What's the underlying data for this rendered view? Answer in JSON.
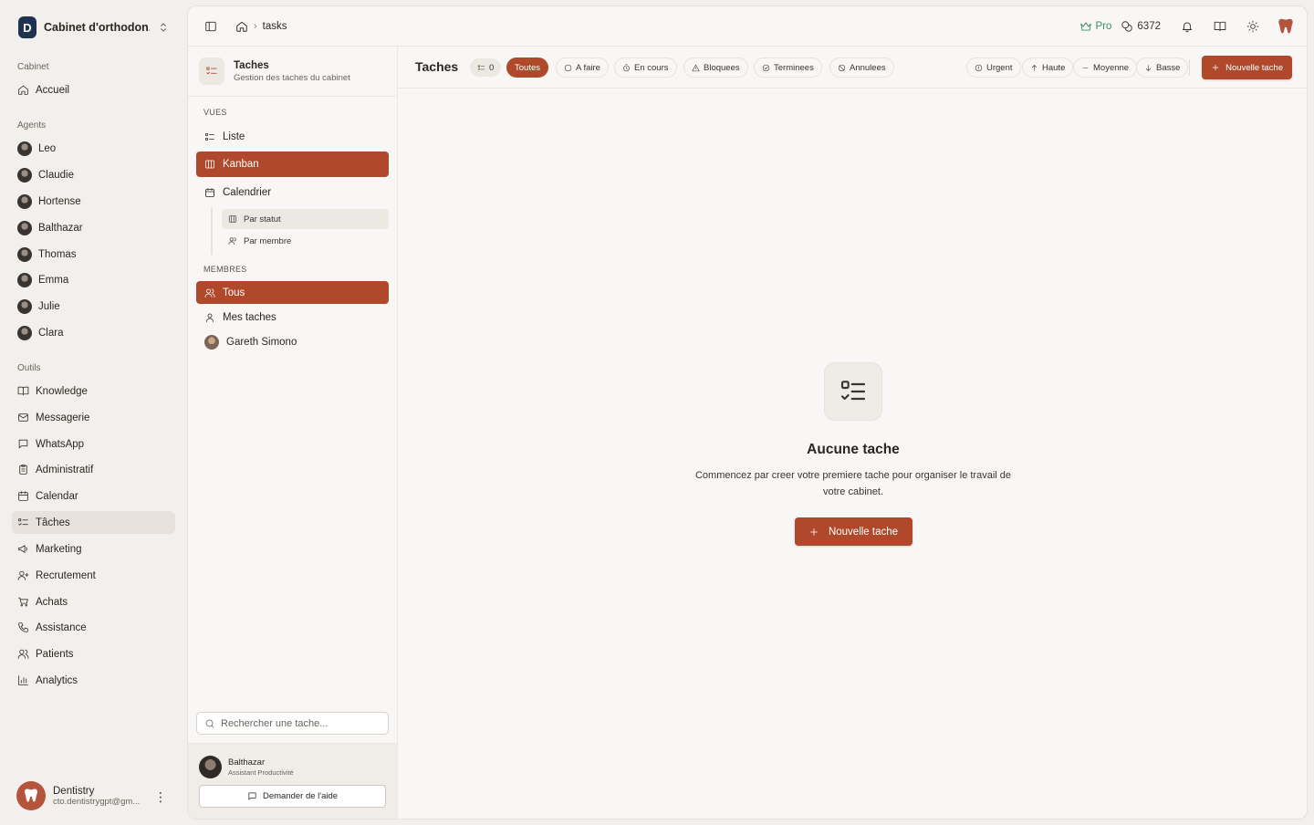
{
  "colors": {
    "accent": "#b0492c",
    "pro": "#3e8a6a",
    "bg": "#f2f0ec",
    "panel": "#f8f7f5"
  },
  "org": {
    "name": "Cabinet d'orthodon...",
    "logo_letter": "D"
  },
  "sidebar": {
    "section_cabinet": "Cabinet",
    "home": "Accueil",
    "section_agents": "Agents",
    "agents": [
      "Leo",
      "Claudie",
      "Hortense",
      "Balthazar",
      "Thomas",
      "Emma",
      "Julie",
      "Clara"
    ],
    "section_tools": "Outils",
    "tools": [
      {
        "label": "Knowledge",
        "icon": "book-icon"
      },
      {
        "label": "Messagerie",
        "icon": "mail-icon"
      },
      {
        "label": "WhatsApp",
        "icon": "chat-icon"
      },
      {
        "label": "Administratif",
        "icon": "clipboard-icon"
      },
      {
        "label": "Calendar",
        "icon": "calendar-icon"
      },
      {
        "label": "Tâches",
        "icon": "tasks-icon",
        "active": true
      },
      {
        "label": "Marketing",
        "icon": "megaphone-icon"
      },
      {
        "label": "Recrutement",
        "icon": "user-plus-icon"
      },
      {
        "label": "Achats",
        "icon": "cart-icon"
      },
      {
        "label": "Assistance",
        "icon": "phone-icon"
      },
      {
        "label": "Patients",
        "icon": "users-icon"
      },
      {
        "label": "Analytics",
        "icon": "bar-chart-icon"
      }
    ],
    "user": {
      "name": "Dentistry",
      "email": "cto.dentistrygpt@gm..."
    }
  },
  "topbar": {
    "breadcrumb_page": "tasks",
    "pro_label": "Pro",
    "credits": "6372"
  },
  "panel": {
    "title": "Taches",
    "subtitle": "Gestion des taches du cabinet",
    "views_label": "VUES",
    "views": [
      "Liste",
      "Kanban",
      "Calendrier"
    ],
    "subviews": [
      "Par statut",
      "Par membre"
    ],
    "members_label": "MEMBRES",
    "members": [
      "Tous",
      "Mes taches",
      "Gareth Simono"
    ],
    "search_placeholder": "Rechercher une tache...",
    "assistant": {
      "name": "Balthazar",
      "role": "Assistant Productivité",
      "help_label": "Demander de l'aide"
    }
  },
  "content": {
    "title": "Taches",
    "count": "0",
    "status_filters": [
      "Toutes",
      "A faire",
      "En cours",
      "Bloquees",
      "Terminees",
      "Annulees"
    ],
    "priority_filters": [
      "Urgent",
      "Haute",
      "Moyenne",
      "Basse"
    ],
    "new_button": "Nouvelle tache",
    "empty": {
      "title": "Aucune tache",
      "description": "Commencez par creer votre premiere tache pour organiser le travail de votre cabinet.",
      "button": "Nouvelle tache"
    }
  }
}
